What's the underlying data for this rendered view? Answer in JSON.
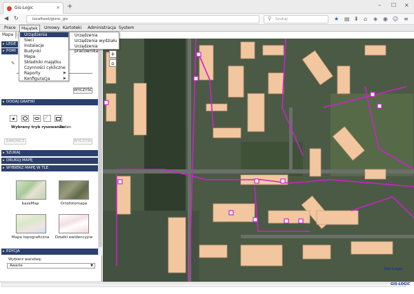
{
  "browser": {
    "tab_title": "Gis-Logic",
    "tab_close": "×",
    "new_tab": "+",
    "window_controls": [
      "–",
      "☐",
      "×"
    ],
    "url": "localhost/gisnc_gis",
    "search_placeholder": "Szukaj"
  },
  "menu": {
    "items": [
      "Prace",
      "Majątek",
      "Umowy",
      "Kartoteki",
      "Administracja",
      "System"
    ],
    "subtabs": [
      "Mapa",
      "Lista"
    ]
  },
  "dropdown": {
    "items": [
      "Urządzenia",
      "Sieci",
      "Instalacje",
      "Budynki",
      "Mapa",
      "Składniki majątku",
      "Czynności cykliczne",
      "Raporty",
      "Konfiguracja"
    ],
    "submenu": [
      "Urządzenia",
      "Urządzenia wydziału",
      "Urządzenia pracownika"
    ]
  },
  "panel": {
    "sections": {
      "legend": "LEGE",
      "pomiary": "POMI",
      "dodaj_grafiki": "DODAJ GRAFIKI",
      "szukaj": "SZUKAJ",
      "drukuj": "DRUKUJ MAPĘ",
      "wybierz": "WYBIERZ MAPĘ W TLE",
      "edycja": "EDYCJA"
    },
    "clear_button": "WYCZYŚĆ",
    "draw_mode_label": "Wybrany tryb rysowania:",
    "draw_mode_value": "Żaden",
    "finish_button": "ZAKOŃCZ",
    "clear2_button": "WYCZYŚĆ",
    "basemaps": [
      {
        "label": "baseMap"
      },
      {
        "label": "Ortofotomapa"
      },
      {
        "label": "Mapa topograficzna"
      },
      {
        "label": "Działki ewidencyjne"
      }
    ],
    "layer_label": "Wybierz warstwę:",
    "layer_value": "Awarie"
  },
  "map": {
    "zoom_in": "+",
    "home": "⌂",
    "logo": "Gis-Logic"
  },
  "footer": {
    "brand": "GIS-LOGIC"
  },
  "colors": {
    "header_blue": "#2b3f6c",
    "network_line": "#cc22cc",
    "building_roof": "#f2c7a0"
  }
}
